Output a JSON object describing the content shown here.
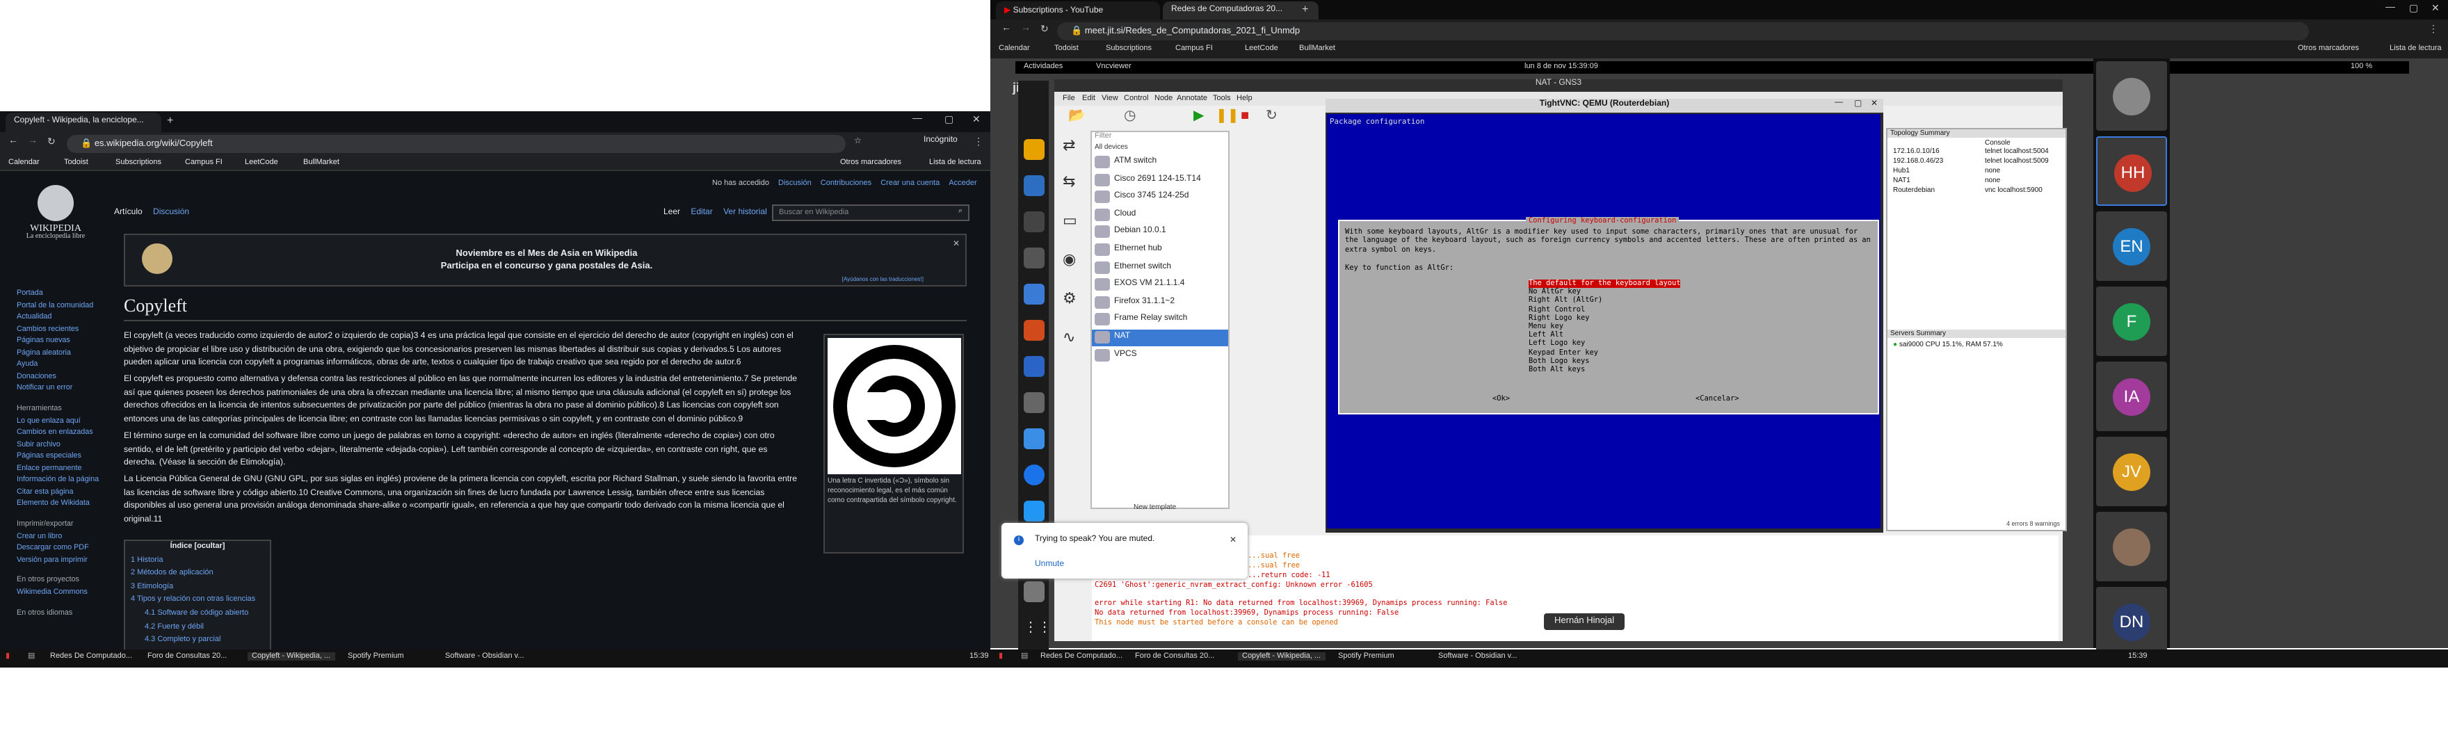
{
  "left": {
    "tabs": [
      {
        "label": "Copyleft - Wikipedia, la enciclope..."
      }
    ],
    "url": "es.wikipedia.org/wiki/Copyleft",
    "incognito": "Incógnito",
    "bookmarks": [
      "Calendar",
      "Todoist",
      "Subscriptions",
      "Campus FI",
      "LeetCode",
      "BullMarket"
    ],
    "other_bookmarks": "Otros marcadores",
    "reading_list": "Lista de lectura"
  },
  "wiki": {
    "logo_title": "WIKIPEDIA",
    "logo_sub": "La enciclopedia libre",
    "userlinks": [
      "No has accedido",
      "Discusión",
      "Contribuciones",
      "Crear una cuenta",
      "Acceder"
    ],
    "tabs": [
      "Artículo",
      "Discusión"
    ],
    "views": [
      "Leer",
      "Editar",
      "Ver historial"
    ],
    "search_placeholder": "Buscar en Wikipedia",
    "banner_l1": "Noviembre es el Mes de Asia en Wikipedia",
    "banner_l2": "Participa en el concurso y gana postales de Asia.",
    "banner_help": "[Ayúdanos con las traducciones!]",
    "title": "Copyleft",
    "p1": "El copyleft (a veces traducido como izquierdo de autor2 o izquierdo de copia)3 4 es una práctica legal que consiste en el ejercicio del derecho de autor (copyright en inglés) con el objetivo de propiciar el libre uso y distribución de una obra, exigiendo que los concesionarios preserven las mismas libertades al distribuir sus copias y derivados.5 Los autores pueden aplicar una licencia con copyleft a programas informáticos, obras de arte, textos o cualquier tipo de trabajo creativo que sea regido por el derecho de autor.6",
    "p2": "El copyleft es propuesto como alternativa y defensa contra las restricciones al público en las que normalmente incurren los editores y la industria del entretenimiento.7 Se pretende así que quienes poseen los derechos patrimoniales de una obra la ofrezcan mediante una licencia libre; al mismo tiempo que una cláusula adicional (el copyleft en sí) protege los derechos ofrecidos en la licencia de intentos subsecuentes de privatización por parte del público (mientras la obra no pase al dominio público).8 Las licencias con copyleft son entonces una de las categorías principales de licencia libre; en contraste con las llamadas licencias permisivas o sin copyleft, y en contraste con el dominio público.9",
    "p3": "El término surge en la comunidad del software libre como un juego de palabras en torno a copyright: «derecho de autor» en inglés (literalmente «derecho de copia») con otro sentido, el de left (pretérito y participio del verbo «dejar», literalmente «dejada-copia»). Left también corresponde al concepto de «izquierda», en contraste con right, que es derecha. (Véase la sección de Etimología).",
    "p4": "La Licencia Pública General de GNU (GNU GPL, por sus siglas en inglés) proviene de la primera licencia con copyleft, escrita por Richard Stallman, y suele siendo la favorita entre las licencias de software libre y código abierto.10 Creative Commons, una organización sin fines de lucro fundada por Lawrence Lessig, también ofrece entre sus licencias disponibles al uso general una provisión análoga denominada share-alike o «compartir igual», en referencia a que hay que compartir todo derivado con la misma licencia que el original.11",
    "caption": "Una letra C invertida («Ɔ»), símbolo sin reconocimiento legal, es el más común como contrapartida del símbolo copyright.",
    "toc_title": "Índice [ocultar]",
    "toc": [
      "1 Historia",
      "2 Métodos de aplicación",
      "3 Etimología",
      "4 Tipos y relación con otras licencias",
      "4.1 Software de código abierto",
      "4.2 Fuerte y débil",
      "4.3 Completo y parcial"
    ],
    "sidebar_main": [
      "Portada",
      "Portal de la comunidad",
      "Actualidad",
      "Cambios recientes",
      "Páginas nuevas",
      "Página aleatoria",
      "Ayuda",
      "Donaciones",
      "Notificar un error"
    ],
    "tools_head": "Herramientas",
    "tools": [
      "Lo que enlaza aquí",
      "Cambios en enlazadas",
      "Subir archivo",
      "Páginas especiales",
      "Enlace permanente",
      "Información de la página",
      "Citar esta página",
      "Elemento de Wikidata"
    ],
    "print_head": "Imprimir/exportar",
    "print": [
      "Crear un libro",
      "Descargar como PDF",
      "Versión para imprimir"
    ],
    "other_head": "En otros proyectos",
    "other": [
      "Wikimedia Commons"
    ],
    "lang_head": "En otros idiomas"
  },
  "right": {
    "tabs": [
      "Subscriptions - YouTube",
      "Redes de Computadoras 20..."
    ],
    "url": "meet.jit.si/Redes_de_Computadoras_2021_fi_Unmdp",
    "bookmarks": [
      "Calendar",
      "Todoist",
      "Subscriptions",
      "Campus FI",
      "LeetCode",
      "BullMarket"
    ],
    "other_bookmarks": "Otros marcadores",
    "reading_list": "Lista de lectura",
    "activities": "Actividades",
    "vncviewer": "Vncviewer",
    "clock": "lun 8 de nov 15:39:09",
    "battery": "100 %",
    "gns_title": "NAT - GNS3",
    "menu": [
      "File",
      "Edit",
      "View",
      "Control",
      "Node",
      "Annotate",
      "Tools",
      "Help"
    ],
    "filter": "Filter",
    "all_devices": "All devices",
    "devices": [
      "ATM switch",
      "Cisco 2691 124-15.T14",
      "Cisco 3745 124-25d",
      "Cloud",
      "Debian 10.0.1",
      "Ethernet hub",
      "Ethernet switch",
      "EXOS VM 21.1.1.4",
      "Firefox 31.1.1~2",
      "Frame Relay switch",
      "NAT",
      "VPCS"
    ],
    "new_template": "New template",
    "vnc_title": "TightVNC: QEMU (Routerdebian)",
    "pkg": "Package configuration",
    "dlg_title": "Configuring keyboard-configuration",
    "dlg_text": "With some keyboard layouts, AltGr is a modifier key used to input some characters, primarily ones that are unusual for the language of the keyboard layout, such as foreign currency symbols and accented letters. These are often printed as an extra symbol on keys.",
    "dlg_q": "Key to function as AltGr:",
    "options": [
      "The default for the keyboard layout",
      "No AltGr key",
      "Right Alt (AltGr)",
      "Right Control",
      "Right Logo key",
      "Menu key",
      "Left Alt",
      "Left Logo key",
      "Keypad Enter key",
      "Both Logo keys",
      "Both Alt keys"
    ],
    "ok": "<Ok>",
    "cancel": "<Cancelar>",
    "topo_head": "Topology Summary",
    "topo_cols": [
      "",
      "Console"
    ],
    "topo": [
      [
        "172.16.0.10/16",
        "telnet localhost:5004"
      ],
      [
        "192.168.0.46/23",
        "telnet localhost:5009"
      ],
      [
        "Hub1",
        "none"
      ],
      [
        "NAT1",
        "none"
      ],
      [
        "Routerdebian",
        "vnc localhost:5900"
      ]
    ],
    "servers_head": "Servers Summary",
    "servers": "sai9000 CPU 15.1%, RAM 57.1%",
    "console": [
      "...sual free",
      "...sual free",
      "...return code: -11",
      "C2691 'Ghost':generic_nvram_extract_config: Unknown error -61605",
      "error while starting R1: No data returned from localhost:39969, Dynamips process running: False",
      "No data returned from localhost:39969, Dynamips process running: False",
      "This node must be started before a console can be opened"
    ],
    "errors": "4 errors 8 warnings",
    "mute_msg": "Trying to speak? You are muted.",
    "unmute": "Unmute",
    "speaker": "Hernán Hinojal",
    "avatars": [
      "HH",
      "EN",
      "F",
      "IA",
      "JV",
      "DN"
    ]
  },
  "taskbar": {
    "left_items": [
      "Redes De Computado...",
      "Foro de Consultas 20...",
      "Copyleft - Wikipedia, ...",
      "Spotify Premium",
      "Software - Obsidian v..."
    ],
    "right_items": [
      "Redes De Computado...",
      "Foro de Consultas 20...",
      "Copyleft - Wikipedia, ...",
      "Spotify Premium",
      "Software - Obsidian v..."
    ],
    "time": "15:39"
  }
}
